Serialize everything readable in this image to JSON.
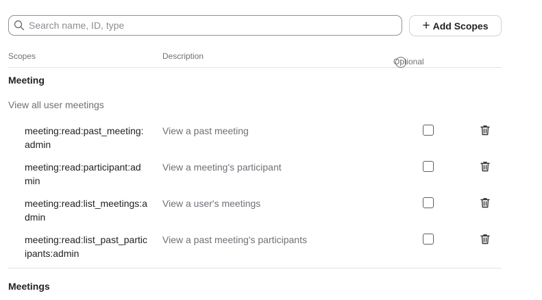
{
  "search": {
    "placeholder": "Search name, ID, type",
    "value": ""
  },
  "add_button": {
    "label": "Add Scopes"
  },
  "table": {
    "headers": {
      "scopes": "Scopes",
      "description": "Description",
      "optional": "Optional",
      "info_glyph": "i"
    }
  },
  "groups": [
    {
      "title": "Meeting",
      "subgroup": "View all user meetings",
      "rows": [
        {
          "scope": "meeting:read:past_meeting:admin",
          "description": "View a past meeting",
          "optional": false
        },
        {
          "scope": "meeting:read:participant:admin",
          "description": "View a meeting's participant",
          "optional": false
        },
        {
          "scope": "meeting:read:list_meetings:admin",
          "description": "View a user's meetings",
          "optional": false
        },
        {
          "scope": "meeting:read:list_past_participants:admin",
          "description": "View a past meeting's participants",
          "optional": false
        }
      ]
    },
    {
      "title": "Meetings"
    }
  ]
}
